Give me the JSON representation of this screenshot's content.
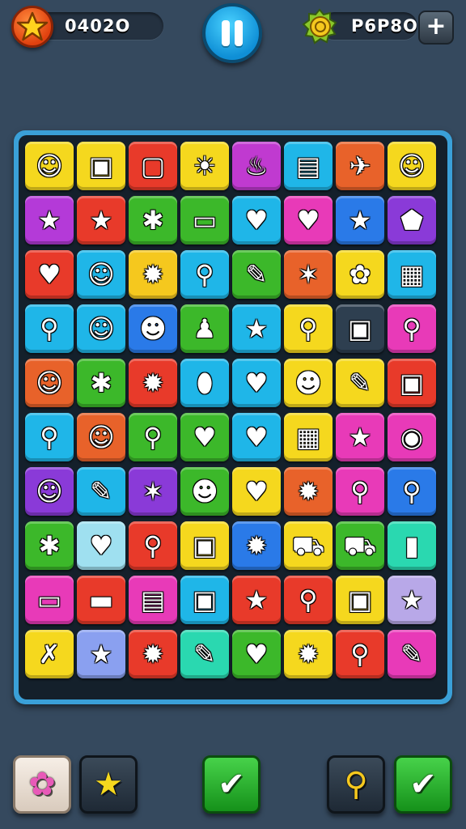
{
  "hud": {
    "score": "0402O",
    "coins": "P6P8O",
    "pause_label": "pause",
    "plus_label": "+"
  },
  "board": {
    "rows": [
      [
        {
          "bg": "#f5d81e",
          "icon": "☺"
        },
        {
          "bg": "#f5d81e",
          "icon": "▣"
        },
        {
          "bg": "#e83a2a",
          "icon": "▢"
        },
        {
          "bg": "#f5d81e",
          "icon": "☀"
        },
        {
          "bg": "#c03ad0",
          "icon": "♨"
        },
        {
          "bg": "#1fb6e8",
          "icon": "▤"
        },
        {
          "bg": "#e8622a",
          "icon": "✈"
        },
        {
          "bg": "#f5d81e",
          "icon": "☺"
        }
      ],
      [
        {
          "bg": "#b43ad8",
          "icon": "★"
        },
        {
          "bg": "#e83a2a",
          "icon": "★"
        },
        {
          "bg": "#3cb82a",
          "icon": "✱"
        },
        {
          "bg": "#3cb82a",
          "icon": "▭"
        },
        {
          "bg": "#1fb6e8",
          "icon": "♥"
        },
        {
          "bg": "#e83ab8",
          "icon": "♥"
        },
        {
          "bg": "#2a7ae8",
          "icon": "★"
        },
        {
          "bg": "#8a3ad8",
          "icon": "⬟"
        }
      ],
      [
        {
          "bg": "#e83a2a",
          "icon": "♥"
        },
        {
          "bg": "#1fb6e8",
          "icon": "☺"
        },
        {
          "bg": "#f5c81e",
          "icon": "✹"
        },
        {
          "bg": "#1fb6e8",
          "icon": "⚲"
        },
        {
          "bg": "#3cb82a",
          "icon": "✎"
        },
        {
          "bg": "#e8622a",
          "icon": "✶"
        },
        {
          "bg": "#f5d81e",
          "icon": "✿"
        },
        {
          "bg": "#1fb6e8",
          "icon": "▦"
        }
      ],
      [
        {
          "bg": "#1fb6e8",
          "icon": "⚲"
        },
        {
          "bg": "#1fb6e8",
          "icon": "☺"
        },
        {
          "bg": "#2a7ae8",
          "icon": "☻"
        },
        {
          "bg": "#3cb82a",
          "icon": "♟"
        },
        {
          "bg": "#1fb6e8",
          "icon": "★"
        },
        {
          "bg": "#f5d81e",
          "icon": "⚲"
        },
        {
          "bg": "#2e3f50",
          "icon": "▣"
        },
        {
          "bg": "#e83ab8",
          "icon": "⚲"
        }
      ],
      [
        {
          "bg": "#e8622a",
          "icon": "☺"
        },
        {
          "bg": "#3cb82a",
          "icon": "✱"
        },
        {
          "bg": "#e83a2a",
          "icon": "✹"
        },
        {
          "bg": "#1fb6e8",
          "icon": "⬮"
        },
        {
          "bg": "#1fb6e8",
          "icon": "♥"
        },
        {
          "bg": "#f5d81e",
          "icon": "☻"
        },
        {
          "bg": "#f5d81e",
          "icon": "✎"
        },
        {
          "bg": "#e83a2a",
          "icon": "▣"
        }
      ],
      [
        {
          "bg": "#1fb6e8",
          "icon": "⚲"
        },
        {
          "bg": "#e8622a",
          "icon": "☺"
        },
        {
          "bg": "#3cb82a",
          "icon": "⚲"
        },
        {
          "bg": "#3cb82a",
          "icon": "♥"
        },
        {
          "bg": "#1fb6e8",
          "icon": "♥"
        },
        {
          "bg": "#f5d81e",
          "icon": "▦"
        },
        {
          "bg": "#e83ab8",
          "icon": "★"
        },
        {
          "bg": "#e83ab8",
          "icon": "◉"
        }
      ],
      [
        {
          "bg": "#8a3ad8",
          "icon": "☺"
        },
        {
          "bg": "#1fb6e8",
          "icon": "✎"
        },
        {
          "bg": "#8a3ad8",
          "icon": "✶"
        },
        {
          "bg": "#3cb82a",
          "icon": "☻"
        },
        {
          "bg": "#f5d81e",
          "icon": "♥"
        },
        {
          "bg": "#e8622a",
          "icon": "✹"
        },
        {
          "bg": "#e83ab8",
          "icon": "⚲"
        },
        {
          "bg": "#2a7ae8",
          "icon": "⚲"
        }
      ],
      [
        {
          "bg": "#3cb82a",
          "icon": "✱"
        },
        {
          "bg": "#9fe0f0",
          "icon": "♥"
        },
        {
          "bg": "#e83a2a",
          "icon": "⚲"
        },
        {
          "bg": "#f5d81e",
          "icon": "▣"
        },
        {
          "bg": "#2a7ae8",
          "icon": "✹"
        },
        {
          "bg": "#f5d81e",
          "icon": "⛟"
        },
        {
          "bg": "#3cb82a",
          "icon": "⛟"
        },
        {
          "bg": "#2ad8b0",
          "icon": "▮"
        }
      ],
      [
        {
          "bg": "#e83ab8",
          "icon": "▭"
        },
        {
          "bg": "#e83a2a",
          "icon": "▬"
        },
        {
          "bg": "#e83ab8",
          "icon": "▤"
        },
        {
          "bg": "#1fb6e8",
          "icon": "▣"
        },
        {
          "bg": "#e83a2a",
          "icon": "★"
        },
        {
          "bg": "#e83a2a",
          "icon": "⚲"
        },
        {
          "bg": "#f5d81e",
          "icon": "▣"
        },
        {
          "bg": "#b8a8e8",
          "icon": "★"
        }
      ],
      [
        {
          "bg": "#f5d81e",
          "icon": "✗"
        },
        {
          "bg": "#8aa0f0",
          "icon": "★"
        },
        {
          "bg": "#e83a2a",
          "icon": "✹"
        },
        {
          "bg": "#2ad8b0",
          "icon": "✎"
        },
        {
          "bg": "#3cb82a",
          "icon": "♥"
        },
        {
          "bg": "#f5d81e",
          "icon": "✹"
        },
        {
          "bg": "#e83a2a",
          "icon": "⚲"
        },
        {
          "bg": "#e83ab8",
          "icon": "✎"
        }
      ]
    ]
  },
  "actions": [
    {
      "name": "candy-booster-button",
      "style": "light",
      "icon": "✿",
      "icon_color": "#e85ab8"
    },
    {
      "name": "shooting-star-button",
      "style": "dark",
      "icon": "★",
      "icon_color": "#f5d81e"
    },
    {
      "name": "confirm-button",
      "style": "green",
      "icon": "✔",
      "icon_color": "#ffffff"
    },
    {
      "name": "search-button",
      "style": "dark",
      "icon": "⚲",
      "icon_color": "#f5c81e"
    },
    {
      "name": "done-button",
      "style": "green",
      "icon": "✔",
      "icon_color": "#ffffff"
    }
  ],
  "colors": {
    "background": "#35495e",
    "board_border": "#3aa0d8",
    "accent_orange": "#e0410f",
    "accent_blue": "#0f8fd6"
  }
}
